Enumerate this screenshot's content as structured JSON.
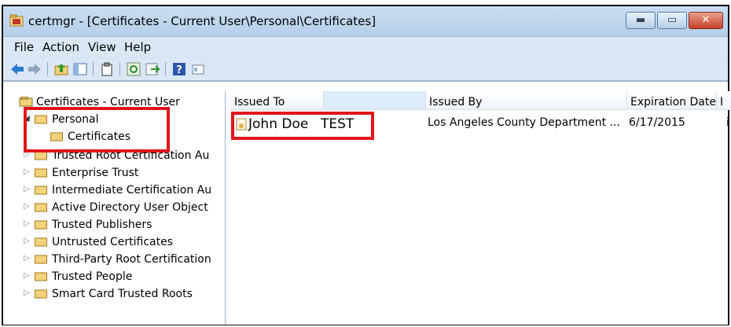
{
  "window": {
    "title": "certmgr - [Certificates - Current User\\Personal\\Certificates]"
  },
  "menu": {
    "file": "File",
    "action": "Action",
    "view": "View",
    "help": "Help"
  },
  "tree": {
    "root": "Certificates - Current User",
    "items": [
      {
        "label": "Personal",
        "expanded": true
      },
      {
        "label": "Certificates",
        "selected": true
      },
      {
        "label": "Trusted Root Certification Au"
      },
      {
        "label": "Enterprise Trust"
      },
      {
        "label": "Intermediate Certification Au"
      },
      {
        "label": "Active Directory User Object"
      },
      {
        "label": "Trusted Publishers"
      },
      {
        "label": "Untrusted Certificates"
      },
      {
        "label": "Third-Party Root Certification"
      },
      {
        "label": "Trusted People"
      },
      {
        "label": "Smart Card Trusted Roots"
      }
    ]
  },
  "list": {
    "columns": {
      "issued_to": "Issued To",
      "issued_by": "Issued By",
      "expiration": "Expiration Date",
      "extra": "I"
    },
    "rows": [
      {
        "issued_to_name": "John Doe",
        "issued_to_suffix": "TEST",
        "issued_by": "Los Angeles County Department ...",
        "expiration": "6/17/2015",
        "extra": "i"
      }
    ]
  },
  "colors": {
    "highlight": "#e0151c",
    "folder": "#f2d27a"
  }
}
